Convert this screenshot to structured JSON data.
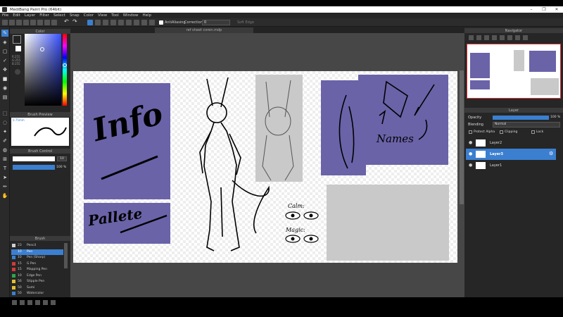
{
  "app": {
    "title": "MediBang Paint Pro (64bit)"
  },
  "menu": [
    "File",
    "Edit",
    "Layer",
    "Filter",
    "Select",
    "Snap",
    "Color",
    "View",
    "Tool",
    "Window",
    "Help"
  ],
  "toolbar": {
    "antialias_label": "AntiAliasing",
    "correction_label": "Correction",
    "correction_value": "0",
    "softedge_label": "Soft Edge"
  },
  "document": {
    "tab_name": "ref sheet coren.mdp"
  },
  "panels": {
    "color": {
      "title": "Color",
      "r": "R:255",
      "g": "G:255",
      "b": "B:255"
    },
    "brush_preview": {
      "title": "Brush Preview",
      "size": "0.75mm"
    },
    "brush_control": {
      "title": "Brush Control",
      "size_value": "10",
      "opacity_value": "100 %"
    },
    "brush": {
      "title": "Brush",
      "items": [
        {
          "size": "23",
          "name": "Pencil",
          "color": "#cfcfcf"
        },
        {
          "size": "10",
          "name": "Pen",
          "color": "#3b7fd0"
        },
        {
          "size": "10",
          "name": "Pen (Sharp)",
          "color": "#3b7fd0"
        },
        {
          "size": "15",
          "name": "G Pen",
          "color": "#d03b3b"
        },
        {
          "size": "15",
          "name": "Mapping Pen",
          "color": "#d03b3b"
        },
        {
          "size": "10",
          "name": "Edge Pen",
          "color": "#2aa84a"
        },
        {
          "size": "56",
          "name": "Stipple Pen",
          "color": "#e0c030"
        },
        {
          "size": "50",
          "name": "Sumi",
          "color": "#e0c030"
        },
        {
          "size": "50",
          "name": "Watercolor",
          "color": "#3b7fd0"
        }
      ]
    },
    "navigator": {
      "title": "Navigator"
    },
    "layer": {
      "title": "Layer",
      "opacity_label": "Opacity",
      "opacity_value": "100 %",
      "blending_label": "Blending",
      "blending_value": "Normal",
      "protect_alpha": "Protect Alpha",
      "clipping": "Clipping",
      "lock": "Lock",
      "layers": [
        {
          "name": "Layer2"
        },
        {
          "name": "Layer3"
        },
        {
          "name": "Layer1"
        }
      ]
    }
  },
  "sheet": {
    "info_text": "Info",
    "pallete_text": "Pallete",
    "names_text": "Names",
    "calm_text": "Calm:",
    "magic_text": "Magic:"
  },
  "colors": {
    "accent": "#3b7fd0",
    "purple": "#6a63a8",
    "panel_bg": "#262626"
  }
}
